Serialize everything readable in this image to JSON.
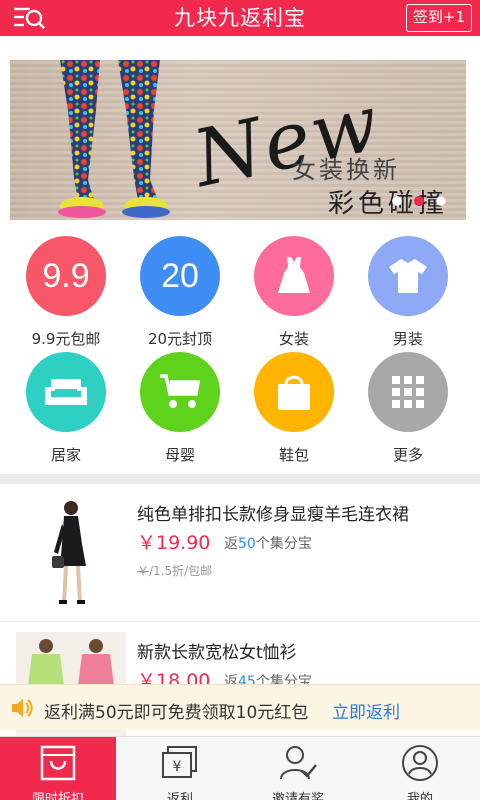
{
  "header": {
    "title": "九块九返利宝",
    "checkin_label": "签到+1",
    "menu_icon": "menu-search-icon"
  },
  "banner": {
    "headline": "New",
    "line1": "女装换新",
    "line2": "彩色碰撞",
    "slide_count": 3,
    "active_slide": 2
  },
  "categories": [
    {
      "label": "9.9元包邮",
      "icon_text": "9.9",
      "color": "#f8576a"
    },
    {
      "label": "20元封顶",
      "icon_text": "20",
      "color": "#3f8ef5"
    },
    {
      "label": "女装",
      "icon": "dress-icon",
      "color": "#ff6b9a"
    },
    {
      "label": "男装",
      "icon": "tshirt-icon",
      "color": "#8ea9f5"
    },
    {
      "label": "居家",
      "icon": "sofa-icon",
      "color": "#2fd0c4"
    },
    {
      "label": "母婴",
      "icon": "stroller-icon",
      "color": "#5fd21c"
    },
    {
      "label": "鞋包",
      "icon": "bag-icon",
      "color": "#ffb400"
    },
    {
      "label": "更多",
      "icon": "grid-icon",
      "color": "#a8a8a8"
    }
  ],
  "products": [
    {
      "name": "纯色单排扣长款修身显瘦羊毛连衣裙",
      "price": "￥19.90",
      "rebate_prefix": "返",
      "rebate_num": "50",
      "rebate_suffix": "个集分宝",
      "orig_price": "￥",
      "meta_rest": "/1.5折/包邮"
    },
    {
      "name": "新款长款宽松女t恤衫",
      "price": "￥18.00",
      "rebate_prefix": "返",
      "rebate_num": "45",
      "rebate_suffix": "个集分宝"
    }
  ],
  "notice": {
    "text": "返利满50元即可免费领取10元红包",
    "link": "立即返利"
  },
  "tabs": [
    {
      "label": "限时折扣",
      "icon": "shopping-bag-icon",
      "active": true
    },
    {
      "label": "返利",
      "icon": "yen-cards-icon",
      "active": false
    },
    {
      "label": "邀请有奖",
      "icon": "invite-user-icon",
      "active": false
    },
    {
      "label": "我的",
      "icon": "profile-icon",
      "active": false
    }
  ],
  "colors": {
    "brand": "#f0294d",
    "link": "#2a7be0"
  }
}
